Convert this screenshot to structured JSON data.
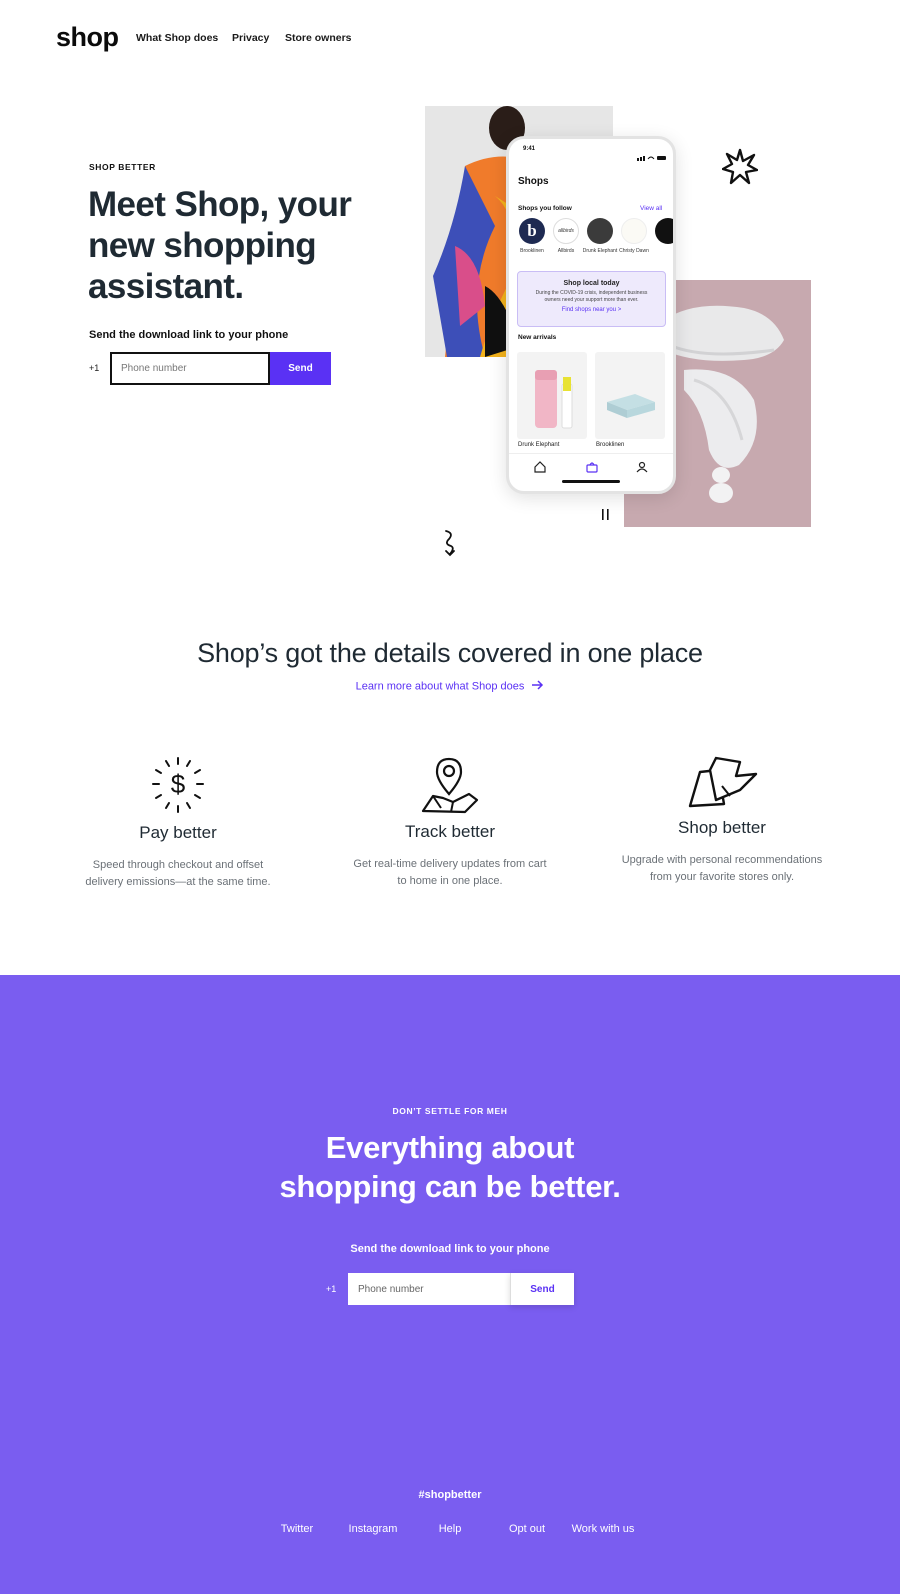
{
  "nav": {
    "logo": "shop",
    "links": [
      "What Shop does",
      "Privacy",
      "Store owners"
    ]
  },
  "hero": {
    "eyebrow": "SHOP BETTER",
    "title": "Meet Shop, your new shopping assistant.",
    "download_label": "Send the download link to your phone",
    "country_code": "+1",
    "phone_placeholder": "Phone number",
    "send_label": "Send"
  },
  "phone_mockup": {
    "time": "9:41",
    "title": "Shops",
    "follow_label": "Shops you follow",
    "view_all": "View all",
    "shops": [
      {
        "name": "Brooklinen",
        "glyph": "b"
      },
      {
        "name": "Allbirds",
        "glyph": "allbirds"
      },
      {
        "name": "Drunk Elephant",
        "glyph": ""
      },
      {
        "name": "Christy Dawn",
        "glyph": ""
      }
    ],
    "card": {
      "title": "Shop local today",
      "body": "During the COVID-19 crisis, independent business owners need your support more than ever.",
      "link": "Find shops near you >"
    },
    "new_arrivals": "New arrivals",
    "products": [
      "Drunk Elephant",
      "Brooklinen"
    ]
  },
  "details": {
    "title": "Shop’s got the details covered in one place",
    "link": "Learn more about what Shop does"
  },
  "features": [
    {
      "title": "Pay better",
      "desc": "Speed through checkout and offset delivery emissions—at the same time.",
      "icon": "dollar-burst-icon"
    },
    {
      "title": "Track better",
      "desc": "Get real-time delivery updates from cart to home in one place.",
      "icon": "map-pin-icon"
    },
    {
      "title": "Shop better",
      "desc": "Upgrade with personal recommendations from your favorite stores only.",
      "icon": "shopping-bags-icon"
    }
  ],
  "cta": {
    "eyebrow": "DON’T SETTLE FOR MEH",
    "title_line1": "Everything about",
    "title_line2": "shopping can be better.",
    "download_label": "Send the download link to your phone",
    "country_code": "+1",
    "phone_placeholder": "Phone number",
    "send_label": "Send"
  },
  "footer": {
    "hashtag": "#shopbetter",
    "links": [
      "Twitter",
      "Instagram",
      "Help",
      "Opt out",
      "Work with us"
    ]
  },
  "colors": {
    "brand": "#5a31f4",
    "cta_bg": "#7a5df0",
    "heading": "#1f2a33"
  }
}
